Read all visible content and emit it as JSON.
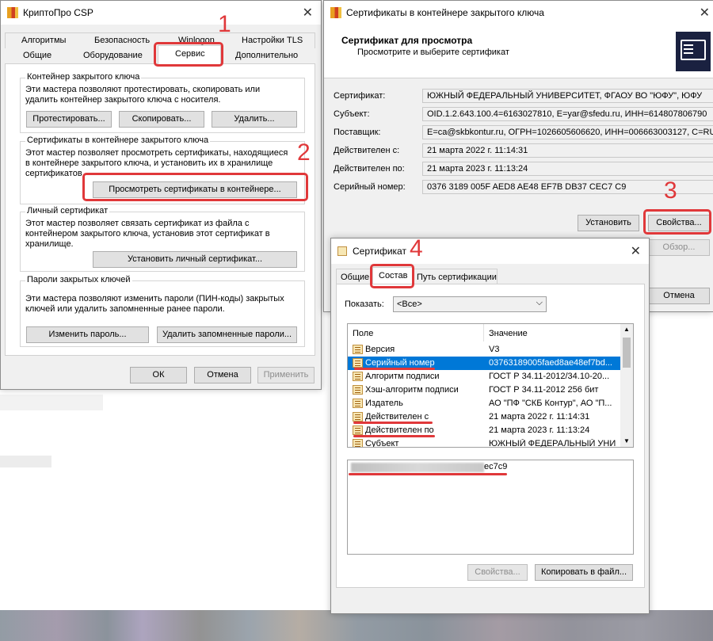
{
  "csp": {
    "title": "КриптоПро CSP",
    "tabs_row1": [
      "Алгоритмы",
      "Безопасность",
      "Winlogon",
      "Настройки TLS"
    ],
    "tabs_row2": [
      "Общие",
      "Оборудование",
      "Сервис",
      "Дополнительно"
    ],
    "group1": {
      "title": "Контейнер закрытого ключа",
      "desc": "Эти мастера позволяют протестировать, скопировать или удалить контейнер закрытого ключа с носителя.",
      "btn_test": "Протестировать...",
      "btn_copy": "Скопировать...",
      "btn_delete": "Удалить..."
    },
    "group2": {
      "title": "Сертификаты в контейнере закрытого ключа",
      "desc": "Этот мастер позволяет просмотреть сертификаты, находящиеся в контейнере закрытого ключа, и установить их в хранилище сертификатов.",
      "btn_view": "Просмотреть сертификаты в контейнере..."
    },
    "group3": {
      "title": "Личный сертификат",
      "desc": "Этот мастер позволяет связать сертификат из файла с контейнером закрытого ключа, установив этот сертификат в хранилище.",
      "btn_install": "Установить личный сертификат..."
    },
    "group4": {
      "title": "Пароли закрытых ключей",
      "desc": "Эти мастера позволяют изменить пароли (ПИН-коды) закрытых ключей или удалить запомненные ранее пароли.",
      "btn_change": "Изменить пароль...",
      "btn_remove": "Удалить запомненные пароли..."
    },
    "ok": "ОК",
    "cancel": "Отмена",
    "apply": "Применить"
  },
  "container": {
    "title": "Сертификаты в контейнере закрытого ключа",
    "header": "Сертификат для просмотра",
    "subheader": "Просмотрите и выберите сертификат",
    "fields": [
      {
        "label": "Сертификат:",
        "value": "ЮЖНЫЙ ФЕДЕРАЛЬНЫЙ УНИВЕРСИТЕТ, ФГАОУ ВО \"ЮФУ\", ЮФУ"
      },
      {
        "label": "Субъект:",
        "value": "OID.1.2.643.100.4=6163027810, E=yar@sfedu.ru, ИНН=614807806790"
      },
      {
        "label": "Поставщик:",
        "value": "E=ca@skbkontur.ru, ОГРН=1026605606620, ИНН=006663003127, C=RU"
      },
      {
        "label": "Действителен с:",
        "value": "21 марта 2022 г. 11:14:31"
      },
      {
        "label": "Действителен по:",
        "value": "21 марта 2023 г. 11:13:24"
      },
      {
        "label": "Серийный номер:",
        "value": "0376 3189 005F AED8 AE48 EF7B DB37 CEC7 C9"
      }
    ],
    "btn_install": "Установить",
    "btn_props": "Свойства...",
    "btn_browse": "Обзор...",
    "btn_cancel": "Отмена"
  },
  "cert": {
    "title": "Сертификат",
    "tabs": [
      "Общие",
      "Состав",
      "Путь сертификации"
    ],
    "show_label": "Показать:",
    "show_value": "<Все>",
    "col_field": "Поле",
    "col_value": "Значение",
    "rows": [
      {
        "field": "Версия",
        "value": "V3"
      },
      {
        "field": "Серийный номер",
        "value": "03763189005faed8ae48ef7bd..."
      },
      {
        "field": "Алгоритм подписи",
        "value": "ГОСТ Р 34.11-2012/34.10-20..."
      },
      {
        "field": "Хэш-алгоритм подписи",
        "value": "ГОСТ Р 34.11-2012 256 бит"
      },
      {
        "field": "Издатель",
        "value": "АО \"ПФ \"СКБ Контур\", АО \"П..."
      },
      {
        "field": "Действителен с",
        "value": "21 марта 2022 г. 11:14:31"
      },
      {
        "field": "Действителен по",
        "value": "21 марта 2023 г. 11:13:24"
      },
      {
        "field": "Субъект",
        "value": "ЮЖНЫЙ ФЕДЕРАЛЬНЫЙ УНИ..."
      }
    ],
    "detail_text": "ec7c9",
    "btn_props": "Свойства...",
    "btn_copy": "Копировать в файл..."
  },
  "annotations": [
    "1",
    "2",
    "3",
    "4"
  ],
  "colors": {
    "annotation": "#e0383a",
    "selection": "#0078d7"
  }
}
